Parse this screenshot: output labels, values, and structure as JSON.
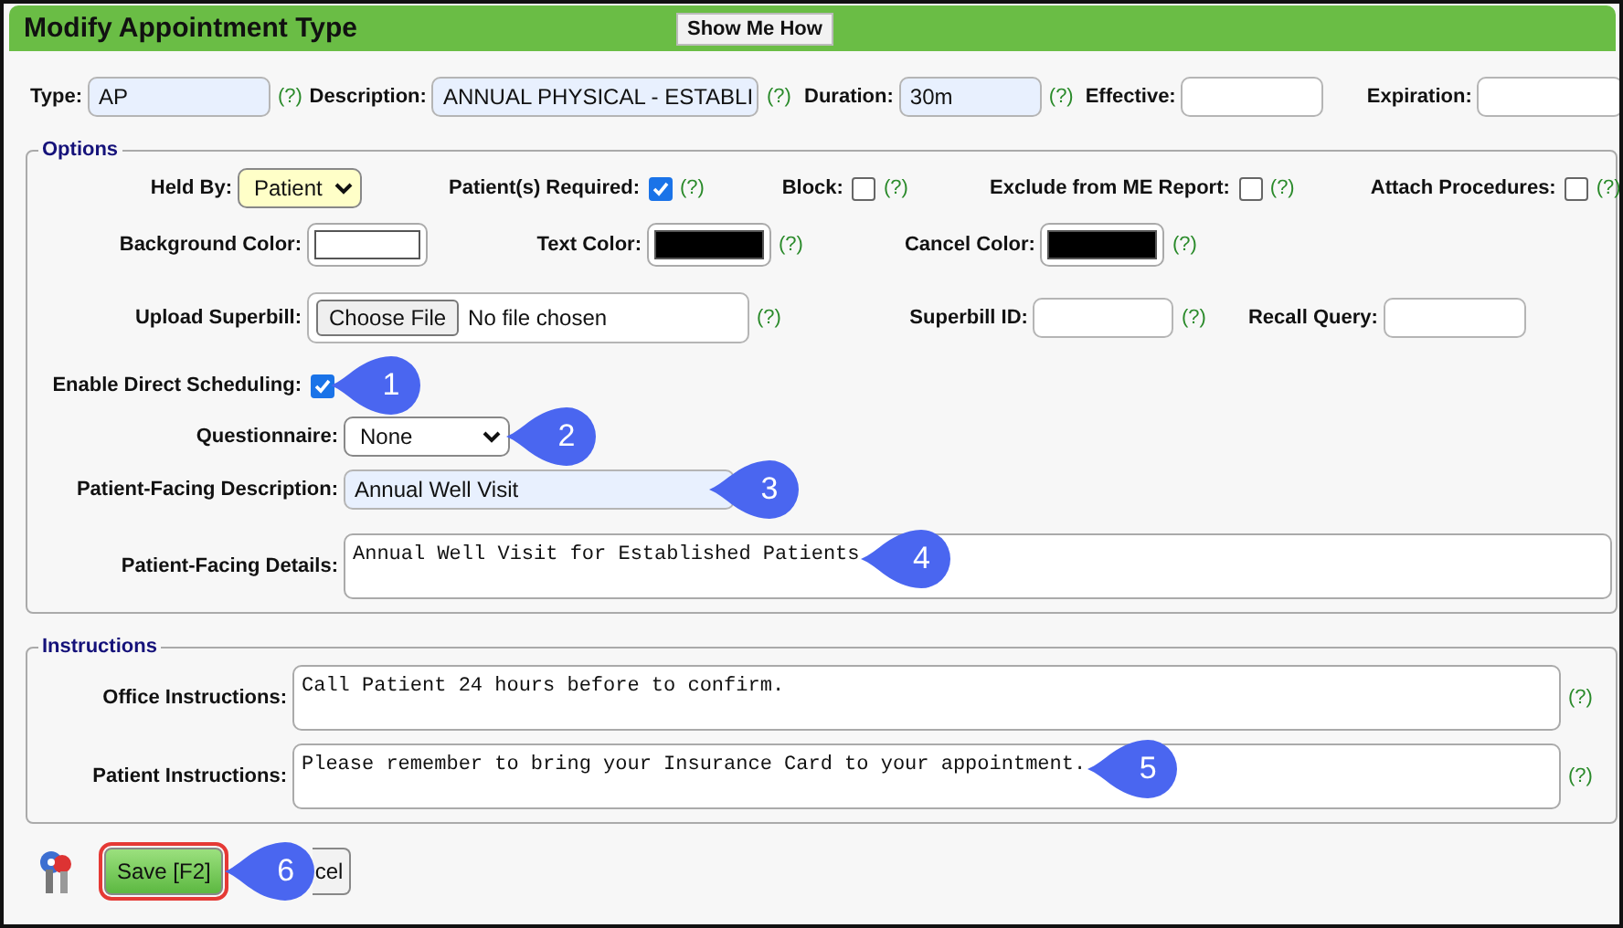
{
  "window": {
    "title": "Modify Appointment Type"
  },
  "header_button": "Show Me How",
  "top_fields": [
    {
      "label": "Type:",
      "kind": "text",
      "value": "AP",
      "autofilled": true,
      "help": "(?)"
    },
    {
      "label": "Description:",
      "kind": "text",
      "value": "ANNUAL PHYSICAL - ESTABLI",
      "autofilled": true,
      "help": "(?)"
    },
    {
      "label": "Duration:",
      "kind": "text",
      "value": "30m",
      "autofilled": true,
      "help": "(?)"
    },
    {
      "label": "Effective:",
      "kind": "text",
      "autofilled": false
    },
    {
      "label": "Expiration:",
      "kind": "text",
      "autofilled": false
    }
  ],
  "options": {
    "legend": "Options",
    "lines": [
      {
        "fields": [
          {
            "label": "Held By:",
            "kind": "select",
            "value": "Patient",
            "required": true
          },
          {
            "label": "Patient(s) Required:",
            "kind": "checkbox",
            "checked": true,
            "help": "(?)"
          },
          {
            "label": "Block:",
            "kind": "checkbox",
            "checked": false,
            "help": "(?)"
          },
          {
            "label": "Exclude from ME Report:",
            "kind": "checkbox",
            "checked": false,
            "help": "(?)"
          },
          {
            "label": "Attach Procedures:",
            "kind": "checkbox",
            "checked": false,
            "help": "(?)"
          }
        ]
      },
      {
        "fields": [
          {
            "label": "Background Color:",
            "kind": "color",
            "color": "#ffffff"
          },
          {
            "label": "Text Color:",
            "kind": "color",
            "color": "#000000",
            "help": "(?)"
          },
          {
            "label": "Cancel Color:",
            "kind": "color",
            "color": "#000000",
            "help": "(?)"
          }
        ]
      },
      {
        "fields": [
          {
            "label": "Upload Superbill:",
            "kind": "file",
            "button": "Choose File",
            "value": "No file chosen",
            "help": "(?)"
          },
          {
            "label": "Superbill ID:",
            "kind": "text",
            "autofilled": false,
            "help": "(?)"
          },
          {
            "label": "Recall Query:",
            "kind": "text",
            "autofilled": false
          }
        ]
      },
      {
        "fields": [
          {
            "label": "Enable Direct Scheduling:",
            "kind": "checkbox",
            "checked": true,
            "callout": "1"
          }
        ]
      },
      {
        "fields": [
          {
            "label": "Questionnaire:",
            "kind": "select",
            "value": "None",
            "required": false,
            "callout": "2"
          }
        ]
      },
      {
        "fields": [
          {
            "label": "Patient-Facing Description:",
            "kind": "text",
            "value": "Annual Well Visit",
            "autofilled": true,
            "callout": "3"
          }
        ]
      },
      {
        "fields": [
          {
            "label": "Patient-Facing Details:",
            "kind": "textarea",
            "value": "Annual Well Visit for Established Patients",
            "callout": "4"
          }
        ]
      }
    ]
  },
  "instructions": {
    "legend": "Instructions",
    "lines": [
      {
        "fields": [
          {
            "label": "Office Instructions:",
            "kind": "textarea",
            "value": "Call Patient 24 hours before to confirm.",
            "help": "(?)"
          }
        ]
      },
      {
        "fields": [
          {
            "label": "Patient Instructions:",
            "kind": "textarea",
            "value": "Please remember to bring your Insurance Card to your appointment.",
            "help": "(?)",
            "callout": "5"
          }
        ]
      }
    ]
  },
  "buttons": [
    {
      "label": "Save [F2]",
      "kind": "save",
      "focused": true,
      "callout": "6"
    },
    {
      "label": "cel",
      "kind": "cancel",
      "focused": false
    }
  ]
}
